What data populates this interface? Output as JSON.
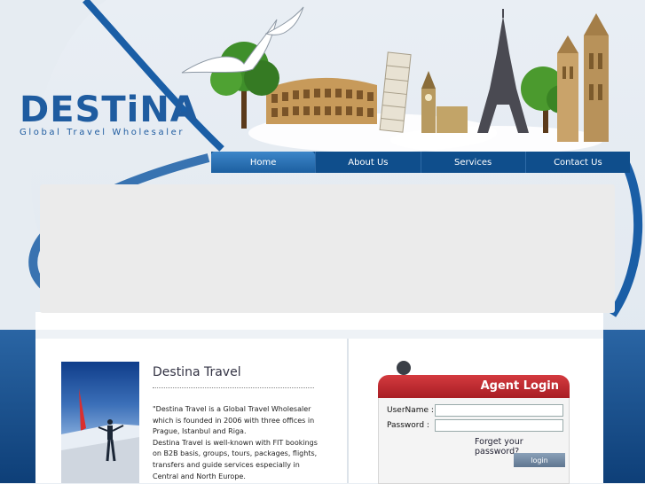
{
  "brand": {
    "name": "DESTiNA",
    "tagline": "Global Travel Wholesaler",
    "color": "#1f5ca0"
  },
  "nav": {
    "items": [
      {
        "label": "Home",
        "active": true
      },
      {
        "label": "About Us"
      },
      {
        "label": "Services"
      },
      {
        "label": "Contact Us"
      }
    ]
  },
  "content": {
    "title": "Destina Travel",
    "paragraph1": "\"Destina Travel is a Global Travel Wholesaler which is founded in 2006 with three offices in Prague, Istanbul and Riga.",
    "paragraph2": "Destina Travel is well-known with FIT bookings on B2B basis, groups, tours, packages, flights, transfers and guide services especially in Central and North Europe."
  },
  "login": {
    "title": "Agent Login",
    "username_label": "UserName :",
    "password_label": "Password :",
    "forgot_link": "Forget your password?",
    "button_label": "login",
    "accent": "#c0282e"
  },
  "icons": [
    "seagull-icon",
    "agent-avatar-icon",
    "landmarks-illustration"
  ]
}
